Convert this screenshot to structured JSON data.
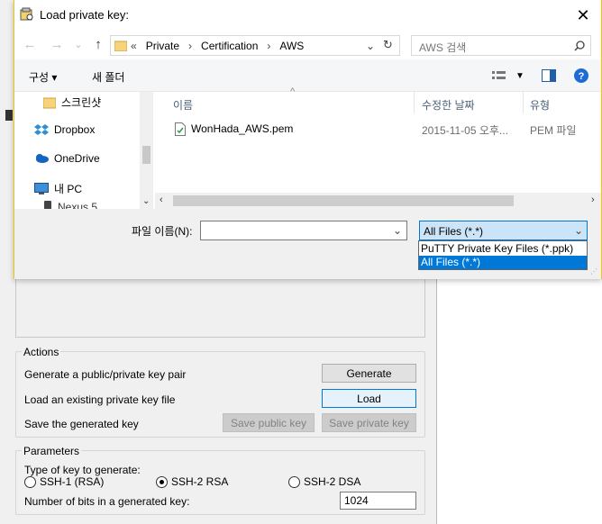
{
  "dialog": {
    "title": "Load private key:",
    "close_label": "✕",
    "nav": {
      "back": "←",
      "forward": "→",
      "dropdown": "⌄",
      "up": "↑"
    },
    "breadcrumb": [
      "«",
      "Private",
      "Certification",
      "AWS"
    ],
    "search_placeholder": "AWS 검색",
    "toolbar": {
      "organize": "구성 ▾",
      "new_folder": "새 폴더"
    },
    "nav_pane": [
      {
        "label": "스크린샷",
        "icon": "folder-icon"
      },
      {
        "label": "Dropbox",
        "icon": "dropbox-icon"
      },
      {
        "label": "OneDrive",
        "icon": "onedrive-icon"
      },
      {
        "label": "내 PC",
        "icon": "computer-icon"
      },
      {
        "label": "Nexus 5",
        "icon": "phone-icon"
      }
    ],
    "columns": {
      "name": "이름",
      "date": "수정한 날짜",
      "type": "유형"
    },
    "files": [
      {
        "name": "WonHada_AWS.pem",
        "date": "2015-11-05 오후...",
        "type": "PEM 파일"
      }
    ],
    "filename_label": "파일 이름(N):",
    "filename_value": "",
    "filetype_selected": "All Files (*.*)",
    "filetype_options": [
      "PuTTY Private Key Files (*.ppk)",
      "All Files (*.*)"
    ]
  },
  "puttygen": {
    "actions": {
      "legend": "Actions",
      "generate_text": "Generate a public/private key pair",
      "generate_btn": "Generate",
      "load_text": "Load an existing private key file",
      "load_btn": "Load",
      "save_text": "Save the generated key",
      "save_public_btn": "Save public key",
      "save_private_btn": "Save private key"
    },
    "parameters": {
      "legend": "Parameters",
      "type_label": "Type of key to generate:",
      "types": [
        "SSH-1 (RSA)",
        "SSH-2 RSA",
        "SSH-2 DSA"
      ],
      "selected_type": "SSH-2 RSA",
      "bits_label": "Number of bits in a generated key:",
      "bits_value": "1024"
    }
  },
  "colors": {
    "accent": "#0078d7",
    "dialog_border": "#f1c40f"
  }
}
